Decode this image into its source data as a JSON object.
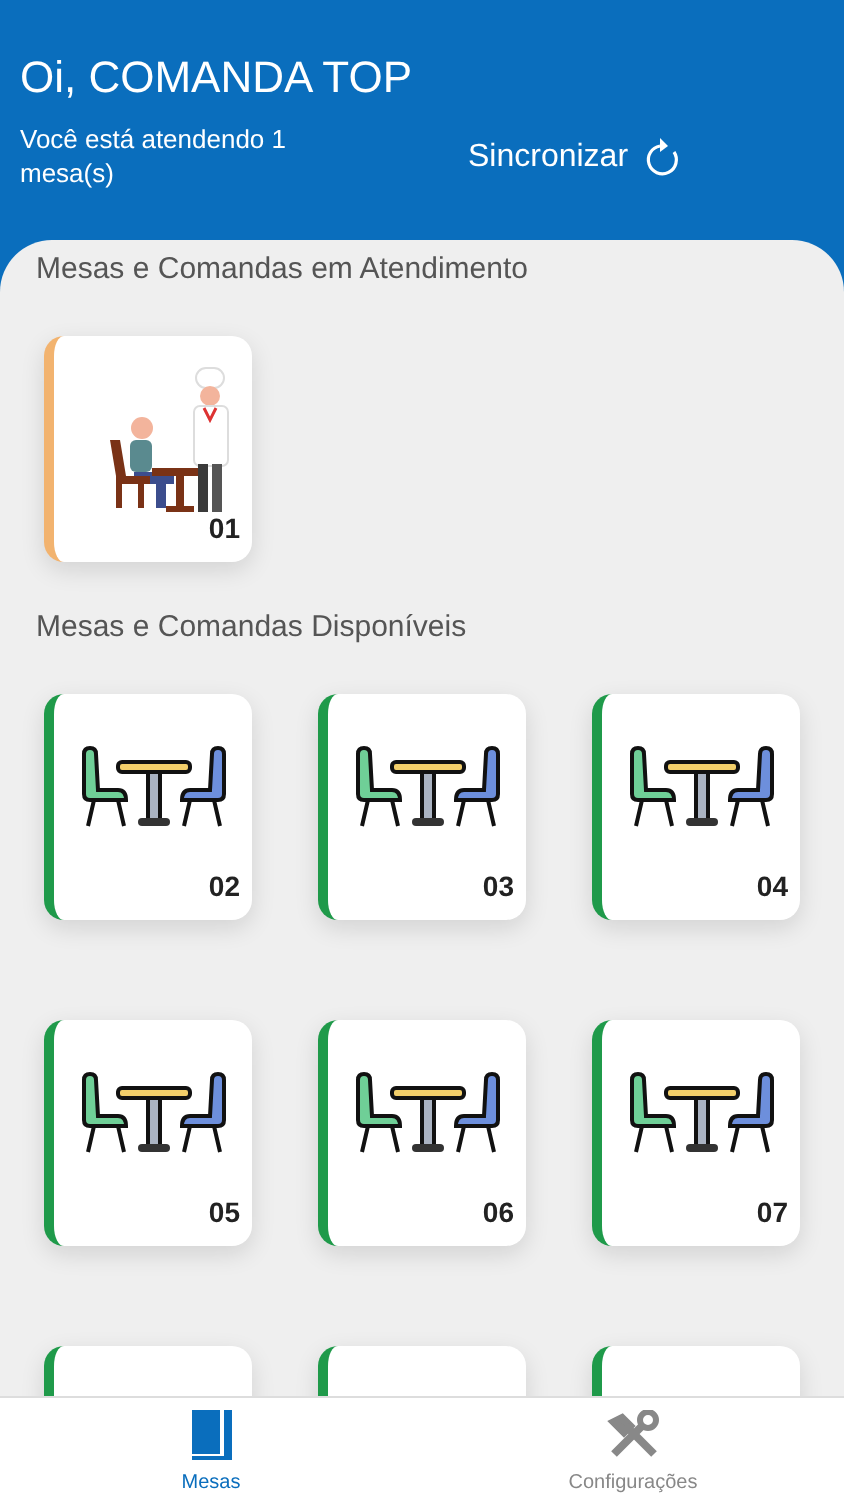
{
  "header": {
    "greeting": "Oi, COMANDA TOP",
    "status": "Você está atendendo 1 mesa(s)",
    "sync_button": "Sincronizar"
  },
  "sections": [
    {
      "title": "Mesas e Comandas em Atendimento",
      "tables": [
        {
          "number": "01",
          "kind": "occupied",
          "color": "#f2b36f"
        }
      ]
    },
    {
      "title": "Mesas e Comandas Disponíveis",
      "tables": [
        {
          "number": "02",
          "kind": "free",
          "color": "#1f9a4a"
        },
        {
          "number": "03",
          "kind": "free",
          "color": "#1f9a4a"
        },
        {
          "number": "04",
          "kind": "free",
          "color": "#1f9a4a"
        },
        {
          "number": "05",
          "kind": "free",
          "color": "#1f9a4a"
        },
        {
          "number": "06",
          "kind": "free",
          "color": "#1f9a4a"
        },
        {
          "number": "07",
          "kind": "free",
          "color": "#1f9a4a"
        },
        {
          "kind": "free",
          "color": "#1f9a4a"
        },
        {
          "kind": "free",
          "color": "#1f9a4a"
        },
        {
          "kind": "free",
          "color": "#1f9a4a"
        }
      ]
    }
  ],
  "tab_bar": [
    {
      "label": "Mesas",
      "kind": "book",
      "selected": true
    },
    {
      "label": "Configurações",
      "kind": "tools",
      "selected": false
    }
  ]
}
